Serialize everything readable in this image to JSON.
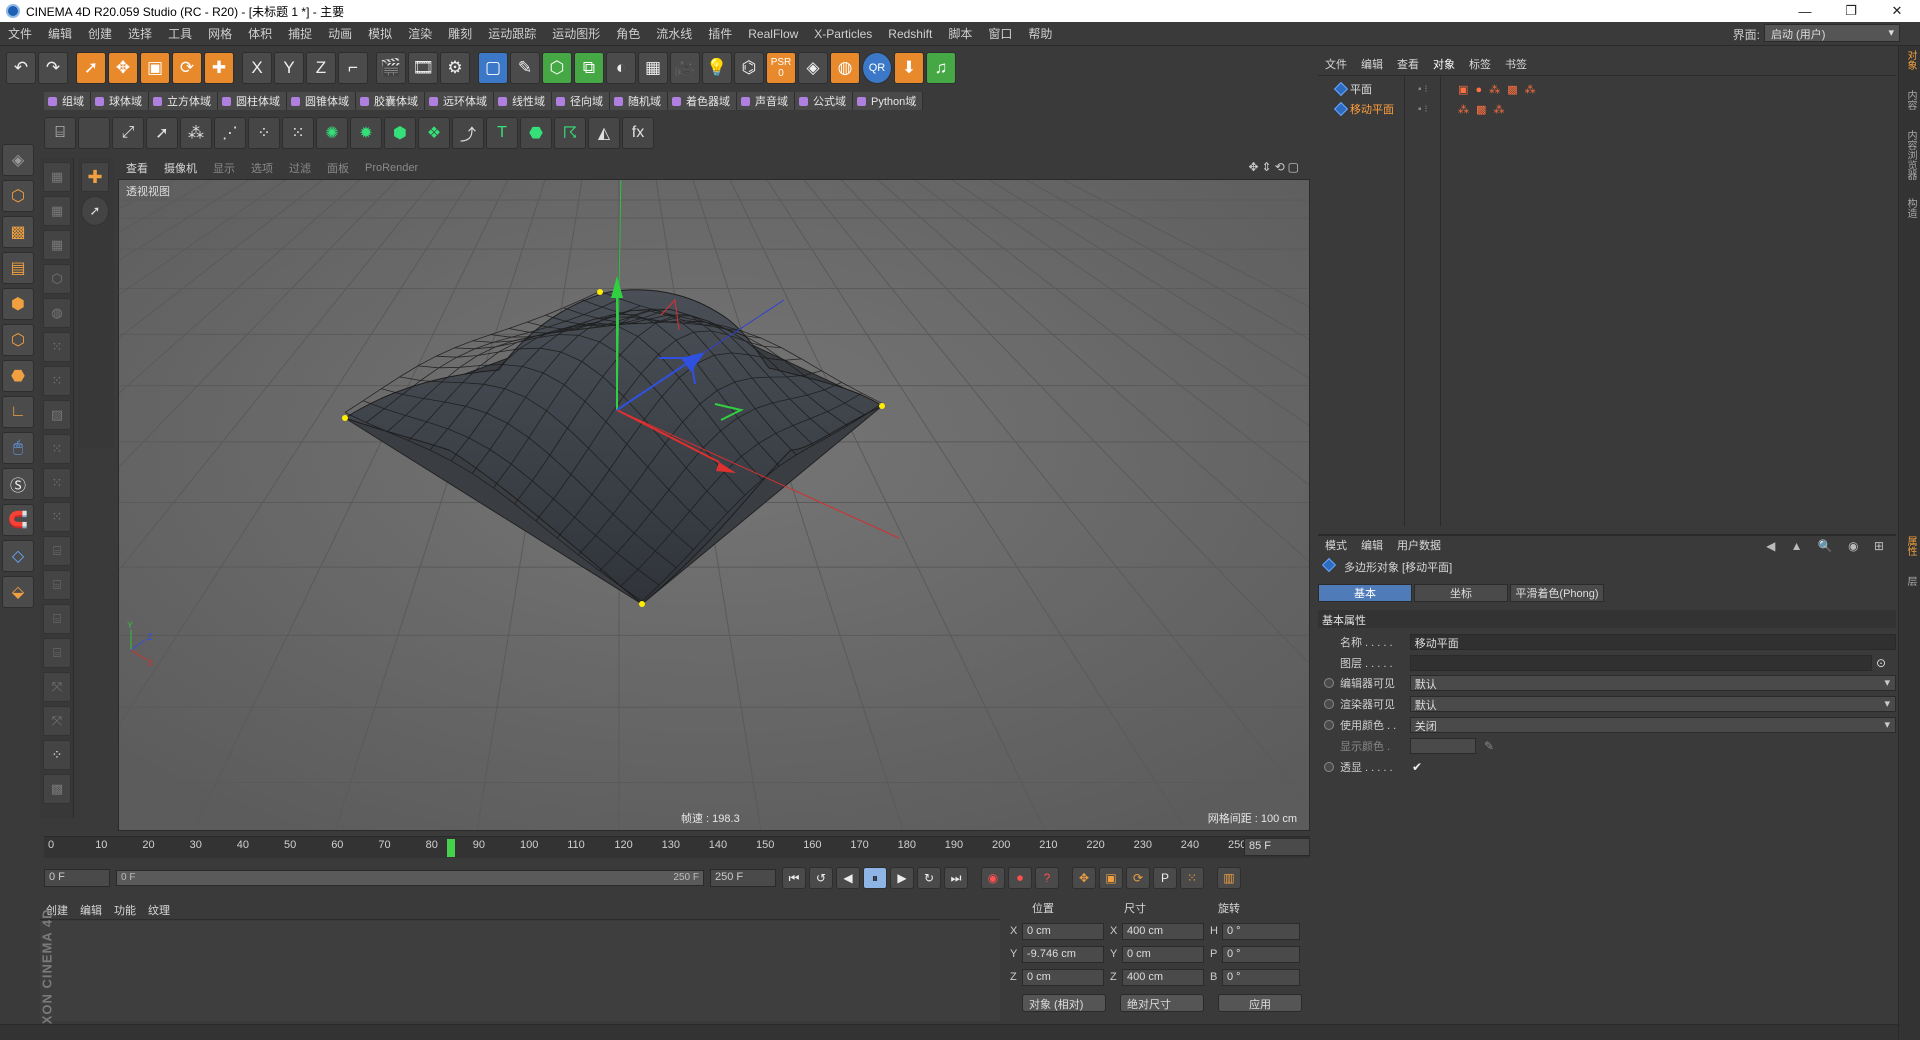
{
  "titlebar": {
    "title": "CINEMA 4D R20.059 Studio (RC - R20) - [未标题 1 *] - 主要",
    "minimize": "—",
    "restore": "❐",
    "close": "✕"
  },
  "menubar": {
    "items": [
      "文件",
      "编辑",
      "创建",
      "选择",
      "工具",
      "网格",
      "体积",
      "捕捉",
      "动画",
      "模拟",
      "渲染",
      "雕刻",
      "运动跟踪",
      "运动图形",
      "角色",
      "流水线",
      "插件",
      "RealFlow",
      "X-Particles",
      "Redshift",
      "脚本",
      "窗口",
      "帮助"
    ],
    "layout_label": "界面:",
    "layout_value": "启动 (用户)"
  },
  "toolbar": {
    "undo": "↶",
    "redo": "↷",
    "x_axis": "X",
    "y_axis": "Y",
    "z_axis": "Z",
    "psr_label": "PSR",
    "psr_value": "0",
    "qr_label": "QR"
  },
  "domainbar": {
    "items": [
      "组域",
      "球体域",
      "立方体域",
      "圆柱体域",
      "圆锥体域",
      "胶囊体域",
      "远环体域",
      "线性域",
      "径向域",
      "随机域",
      "着色器域",
      "声音域",
      "公式域",
      "Python域"
    ]
  },
  "iconrow": {
    "text_tool": "T",
    "fx": "fx"
  },
  "viewport": {
    "tabs": [
      "查看",
      "摄像机",
      "显示",
      "选项",
      "过滤",
      "面板",
      "ProRender"
    ],
    "view_name": "透视视图",
    "fps": "帧速 : 198.3",
    "grid_spacing": "网格间距 : 100 cm",
    "nav_icons": "✥⇕⟲▢",
    "axis_x": "X",
    "axis_y": "Y",
    "axis_z": "Z"
  },
  "timeline": {
    "ticks": [
      "0",
      "10",
      "20",
      "30",
      "40",
      "50",
      "60",
      "70",
      "80",
      "90",
      "100",
      "110",
      "120",
      "130",
      "140",
      "150",
      "160",
      "170",
      "180",
      "190",
      "200",
      "210",
      "220",
      "230",
      "240",
      "250"
    ],
    "current_frame": 85,
    "max_frame": 250,
    "current_frame_label": "85 F"
  },
  "transport": {
    "start_field": "0 F",
    "range_start": "0 F",
    "range_end": "250 F",
    "end_field": "250 F",
    "motion_p": "P"
  },
  "material": {
    "menu": [
      "创建",
      "编辑",
      "功能",
      "纹理"
    ],
    "logo": "MAXON CINEMA 4D"
  },
  "coords": {
    "col_position": "位置",
    "col_size": "尺寸",
    "col_rotation": "旋转",
    "rows": [
      {
        "axis": "X",
        "pos": "0 cm",
        "size_axis": "X",
        "size": "400 cm",
        "rot_axis": "H",
        "rot": "0 °"
      },
      {
        "axis": "Y",
        "pos": "-9.746 cm",
        "size_axis": "Y",
        "size": "0 cm",
        "rot_axis": "P",
        "rot": "0 °"
      },
      {
        "axis": "Z",
        "pos": "0 cm",
        "size_axis": "Z",
        "size": "400 cm",
        "rot_axis": "B",
        "rot": "0 °"
      }
    ],
    "mode_select": "对象 (相对)",
    "size_select": "绝对尺寸",
    "apply": "应用"
  },
  "objects": {
    "menu": [
      "文件",
      "编辑",
      "查看",
      "对象",
      "标签",
      "书签"
    ],
    "items": [
      {
        "name": "平面",
        "selected": false
      },
      {
        "name": "移动平面",
        "selected": true
      }
    ],
    "vis_dots": "▪ ⁝"
  },
  "attributes": {
    "menu": [
      "模式",
      "编辑",
      "用户数据"
    ],
    "header_icons": "◀ ▲ 🔍 ◉ ⊞",
    "object_title": "多边形对象 [移动平面]",
    "tabs": [
      "基本",
      "坐标",
      "平滑着色(Phong)"
    ],
    "section": "基本属性",
    "fields": [
      {
        "label": "名称 . . . . .",
        "value": "移动平面"
      },
      {
        "label": "图层 . . . . .",
        "value": ""
      },
      {
        "label": "编辑器可见",
        "value": "默认"
      },
      {
        "label": "渲染器可见",
        "value": "默认"
      },
      {
        "label": "使用颜色 . .",
        "value": "关闭"
      },
      {
        "label": "显示颜色 .",
        "value": ""
      },
      {
        "label": "透显 . . . . .",
        "value": "✔"
      }
    ]
  },
  "side_tabs": [
    "对象",
    "内容",
    "内容浏览器",
    "构造",
    "属性",
    "层"
  ],
  "colors": {
    "accent": "#f0a040",
    "selection_blue": "#4f7cb8",
    "axis_x": "#e03030",
    "axis_y": "#30d040",
    "axis_z": "#3050e0"
  }
}
